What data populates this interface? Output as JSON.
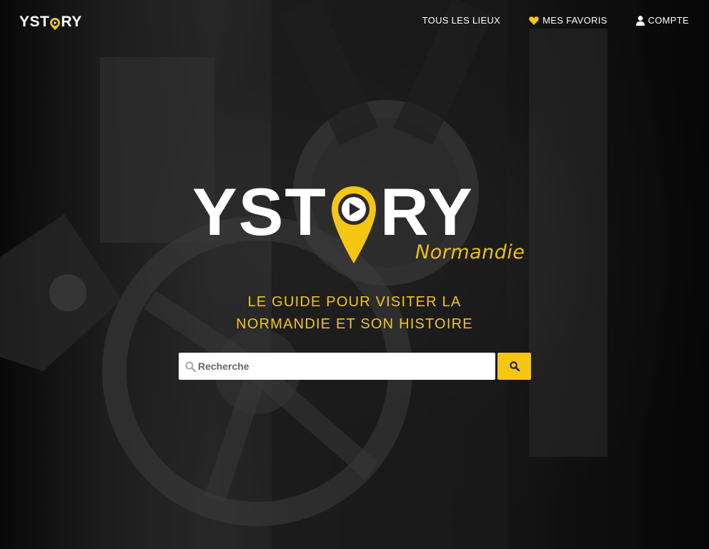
{
  "header": {
    "brand": {
      "part1": "YST",
      "part2": "RY"
    },
    "nav": [
      {
        "label": "TOUS LES LIEUX",
        "icon": ""
      },
      {
        "label": "MES FAVORIS",
        "icon": "heart-icon"
      },
      {
        "label": "COMPTE",
        "icon": "user-icon"
      }
    ]
  },
  "hero": {
    "logo": {
      "part1": "YST",
      "part2": "RY",
      "sub": "Normandie"
    },
    "tagline_line1": "LE GUIDE POUR VISITER LA",
    "tagline_line2": "NORMANDIE ET SON HISTOIRE"
  },
  "search": {
    "placeholder": "Recherche",
    "value": ""
  },
  "colors": {
    "accent": "#f5c713",
    "tagline": "#f2c614",
    "background": "#1a1a1a"
  }
}
